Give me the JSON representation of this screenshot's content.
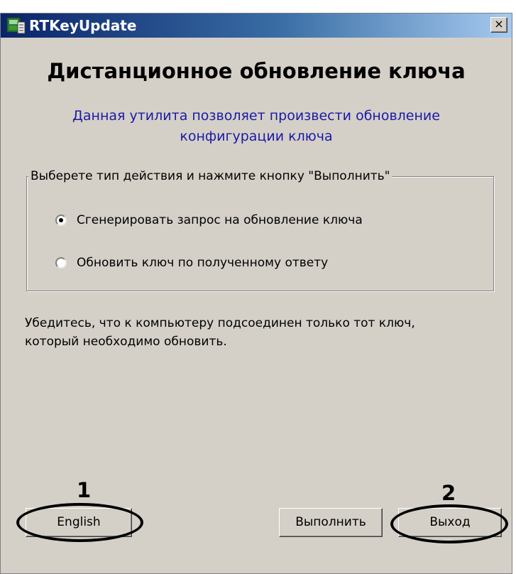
{
  "window": {
    "title": "RTKeyUpdate",
    "close_label": "×"
  },
  "main": {
    "heading": "Дистанционное обновление ключа",
    "description_line1": "Данная утилита позволяет произвести обновление",
    "description_line2": "конфигурации ключа",
    "group": {
      "legend": "Выберете тип действия и нажмите кнопку \"Выполнить\"",
      "options": [
        {
          "label": "Сгенерировать запрос на обновление ключа",
          "checked": true
        },
        {
          "label": "Обновить ключ по полученному ответу",
          "checked": false
        }
      ]
    },
    "warning_line1": "Убедитесь, что к компьютеру подсоединен только тот ключ,",
    "warning_line2": "который необходимо обновить."
  },
  "footer": {
    "english_label": "English",
    "execute_label": "Выполнить",
    "exit_label": "Выход"
  },
  "annotations": {
    "marker_1": "1",
    "marker_2": "2"
  },
  "colors": {
    "title_bar_start": "#0a246a",
    "title_bar_end": "#a6caf0",
    "window_bg": "#d4d0c8",
    "description_text": "#1a1aa6"
  },
  "icons": {
    "app": "app-icon",
    "close": "close-icon"
  }
}
